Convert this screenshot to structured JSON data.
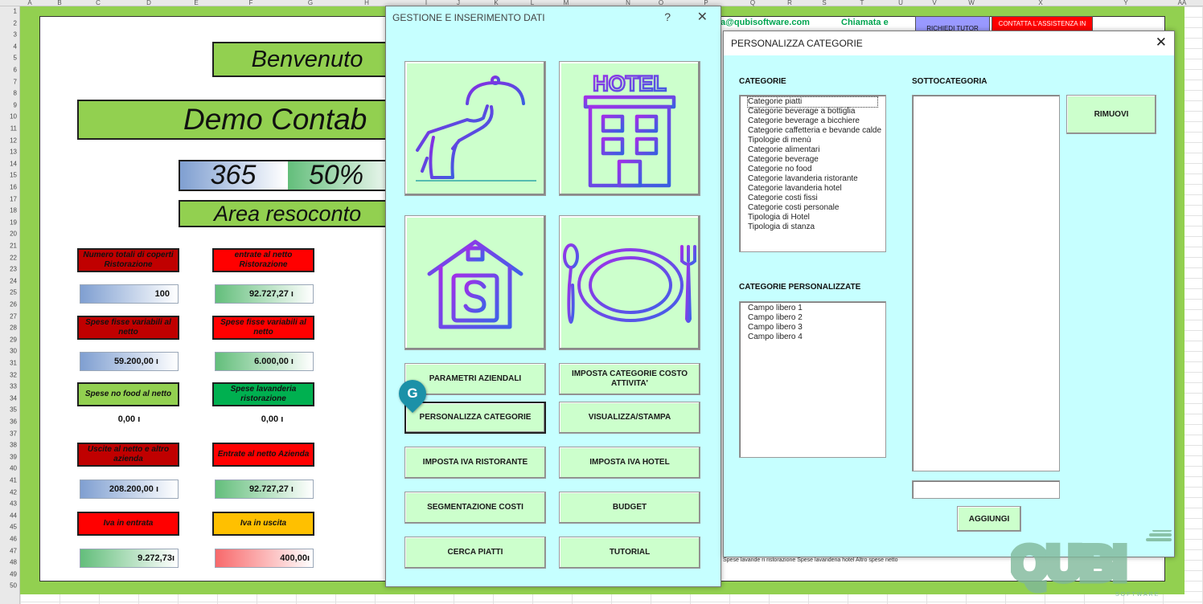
{
  "spreadsheet": {
    "columns": [
      "A",
      "B",
      "C",
      "D",
      "E",
      "F",
      "G",
      "H",
      "I",
      "J",
      "K",
      "L",
      "M",
      "N",
      "O",
      "P",
      "Q",
      "R",
      "S",
      "T",
      "U",
      "V",
      "W",
      "X",
      "Y",
      "AA"
    ],
    "rows": [
      "1",
      "2",
      "3",
      "4",
      "5",
      "6",
      "7",
      "8",
      "9",
      "10",
      "11",
      "12",
      "13",
      "14",
      "15",
      "16",
      "17",
      "18",
      "19",
      "20",
      "21",
      "22",
      "23",
      "24",
      "25",
      "26",
      "27",
      "28",
      "29",
      "30",
      "31",
      "32",
      "33",
      "34",
      "35",
      "36",
      "37",
      "38",
      "39",
      "40",
      "41",
      "42",
      "43",
      "44",
      "45",
      "46",
      "47",
      "48",
      "49",
      "50"
    ],
    "welcome": "Benvenuto",
    "demo_title": "Demo Contab",
    "days": "365",
    "percent": "50%",
    "area_title": "Area resoconto",
    "email": "a@qubisoftware.com",
    "chiamata": "Chiamata e",
    "tutor_btn": "RICHIEDI TUTOR",
    "assist_btn": "CONTATTA L'ASSISTENZA IN",
    "cells": [
      {
        "label": "Numero totali di coperti Ristorazione",
        "label_style": "dred",
        "value": "100",
        "value_style": "blue"
      },
      {
        "label": "entrate al netto Ristorazione",
        "label_style": "red",
        "value": "92.727,27 ı",
        "value_style": "green"
      },
      {
        "label": "Spese fisse variabili al netto",
        "label_style": "dred",
        "value": "59.200,00 ı",
        "value_style": "blue"
      },
      {
        "label": "Spese fisse variabili al netto",
        "label_style": "red",
        "value": "6.000,00 ı",
        "value_style": "green"
      },
      {
        "label": "Spese no food al netto",
        "label_style": "lgreen",
        "value": "0,00 ı",
        "value_style": "plain"
      },
      {
        "label": "Spese lavanderia ristorazione",
        "label_style": "dgreen",
        "value": "0,00 ı",
        "value_style": "plain"
      },
      {
        "label": "Uscite al netto e altro azienda",
        "label_style": "dred",
        "value": "208.200,00 ı",
        "value_style": "blue"
      },
      {
        "label": "Entrate al netto Azienda",
        "label_style": "red",
        "value": "92.727,27 ı",
        "value_style": "green"
      },
      {
        "label": "Iva in entrata",
        "label_style": "red",
        "value": "9.272,73ı",
        "value_style": "green"
      },
      {
        "label": "Iva in uscita",
        "label_style": "yellow",
        "value": "400,00ı",
        "value_style": "redg"
      }
    ],
    "legend": "Spese lavande ri ristorazione  Spese lavanderia hotel     Altro spese netto"
  },
  "dialog_main": {
    "title": "GESTIONE E INSERIMENTO DATI",
    "help": "?",
    "close": "✕",
    "tiles": [
      {
        "name": "restaurant-tile",
        "icon": "waiter-cloche-icon"
      },
      {
        "name": "hotel-tile",
        "icon": "hotel-building-icon",
        "sign": "HOTEL"
      },
      {
        "name": "finance-tile",
        "icon": "money-house-icon"
      },
      {
        "name": "dishes-tile",
        "icon": "plate-cutlery-icon"
      }
    ],
    "buttons": [
      "PARAMETRI AZIENDALI",
      "IMPOSTA CATEGORIE COSTO ATTIVITA'",
      "PERSONALIZZA CATEGORIE",
      "VISUALIZZA/STAMPA",
      "IMPOSTA IVA RISTORANTE",
      "IMPOSTA IVA HOTEL",
      "SEGMENTAZIONE COSTI",
      "BUDGET",
      "CERCA PIATTI",
      "TUTORIAL"
    ],
    "marker": "G"
  },
  "dialog_categories": {
    "title": "PERSONALIZZA CATEGORIE",
    "close": "✕",
    "categories_label": "CATEGORIE",
    "subcategory_label": "SOTTOCATEGORIA",
    "custom_label": "CATEGORIE PERSONALIZZATE",
    "categories": [
      "Categorie piatti",
      "Categorie beverage a bottiglia",
      "Categorie beverage a bicchiere",
      "Categorie caffetteria e bevande calde",
      "Tipologie di menù",
      "Categorie alimentari",
      "Categorie beverage",
      "Categorie no food",
      "Categorie lavanderia ristorante",
      "Categorie lavanderia hotel",
      "Categorie costi fissi",
      "Categorie costi personale",
      "Tipologia di Hotel",
      "Tipologia di stanza"
    ],
    "custom_categories": [
      "Campo libero 1",
      "Campo libero 2",
      "Campo libero 3",
      "Campo libero 4"
    ],
    "remove_button": "RIMUOVI",
    "add_button": "AGGIUNGI",
    "new_subcategory_value": ""
  },
  "logo": {
    "text": "QUBI",
    "sub": "SOFTWARE",
    "registered": "®"
  },
  "colors": {
    "dialog_bg": "#c6ffff",
    "button_bg": "#ccffcc",
    "sheet_green": "#92d050",
    "icon_purple": "#7b3fe4"
  }
}
